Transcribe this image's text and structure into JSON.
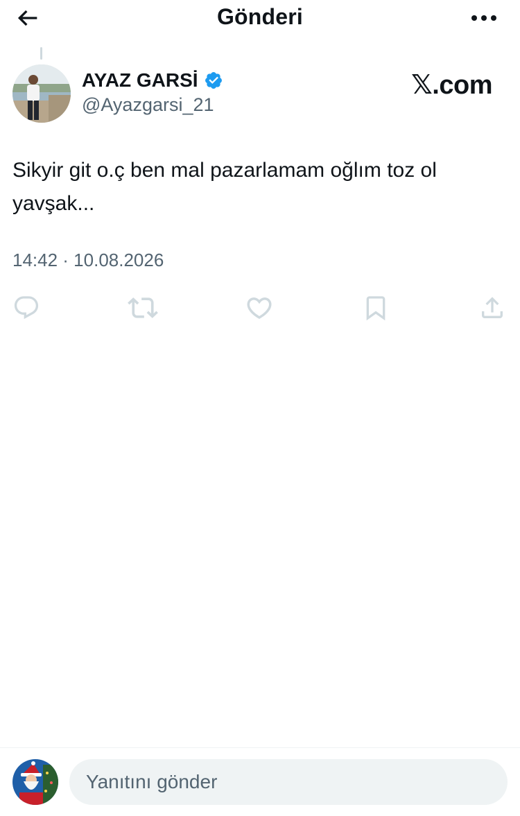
{
  "header": {
    "title": "Gönderi"
  },
  "post": {
    "author_name": "AYAZ GARSİ",
    "author_handle": "@Ayazgarsi_21",
    "verified": true,
    "brand_x": "𝕏",
    "brand_com": ".com",
    "text": "Sikyir git o.ç ben mal pazarlamam oğlım toz ol\nyavşak...",
    "timestamp": "14:42 · 10.08.2026"
  },
  "actions": [
    "reply-icon",
    "repost-icon",
    "like-icon",
    "bookmark-icon",
    "share-icon"
  ],
  "reply_bar": {
    "placeholder": "Yanıtını gönder"
  },
  "colors": {
    "text": "#0f1419",
    "secondary": "#536471",
    "verified": "#1d9bf0",
    "input_bg": "#eff3f4",
    "action_icon": "#cfd9de"
  }
}
